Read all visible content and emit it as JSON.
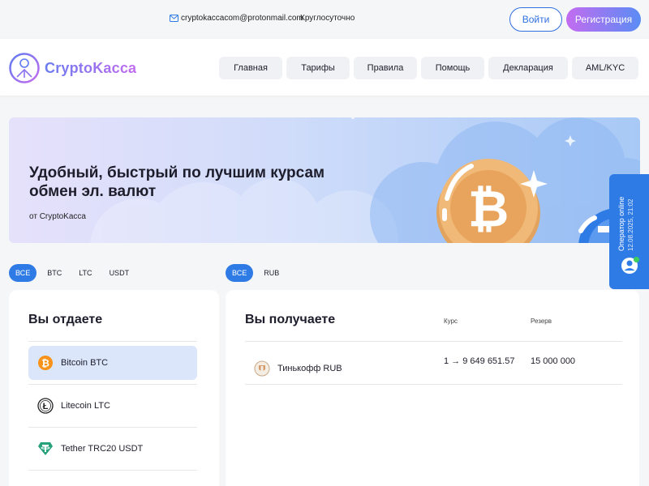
{
  "topbar": {
    "email": "cryptokaccacom@protonmail.com",
    "hours": "Круглосуточно",
    "login_label": "Войти",
    "register_label": "Регистрация"
  },
  "header": {
    "logo_text": "CryptoKacca",
    "nav": [
      "Главная",
      "Тарифы",
      "Правила",
      "Помощь",
      "Декларация",
      "AML/KYC"
    ]
  },
  "banner": {
    "title": "Удобный, быстрый по лучшим курсам обмен эл. валют",
    "subtitle": "от CryptoKacca"
  },
  "operator": {
    "status": "Оператор online",
    "datetime": "12.08.2025, 21:02"
  },
  "give": {
    "filters": [
      "ВСЕ",
      "BTC",
      "LTC",
      "USDT"
    ],
    "active_filter": "ВСЕ",
    "title": "Вы отдаете",
    "items": [
      {
        "label": "Bitcoin BTC",
        "icon": "bitcoin-icon",
        "active": true
      },
      {
        "label": "Litecoin LTC",
        "icon": "litecoin-icon",
        "active": false
      },
      {
        "label": "Tether TRC20 USDT",
        "icon": "tether-icon",
        "active": false
      }
    ]
  },
  "receive": {
    "filters": [
      "ВСЕ",
      "RUB"
    ],
    "active_filter": "ВСЕ",
    "title": "Вы получаете",
    "col_rate": "Курс",
    "col_reserve": "Резерв",
    "items": [
      {
        "label": "Тинькофф RUB",
        "icon": "tinkoff-icon",
        "rate": "1 → 9 649 651.57",
        "reserve": "15 000 000"
      }
    ]
  },
  "colors": {
    "accent": "#2f7be6",
    "bitcoin": "#f7931a",
    "tether": "#26a17b"
  }
}
